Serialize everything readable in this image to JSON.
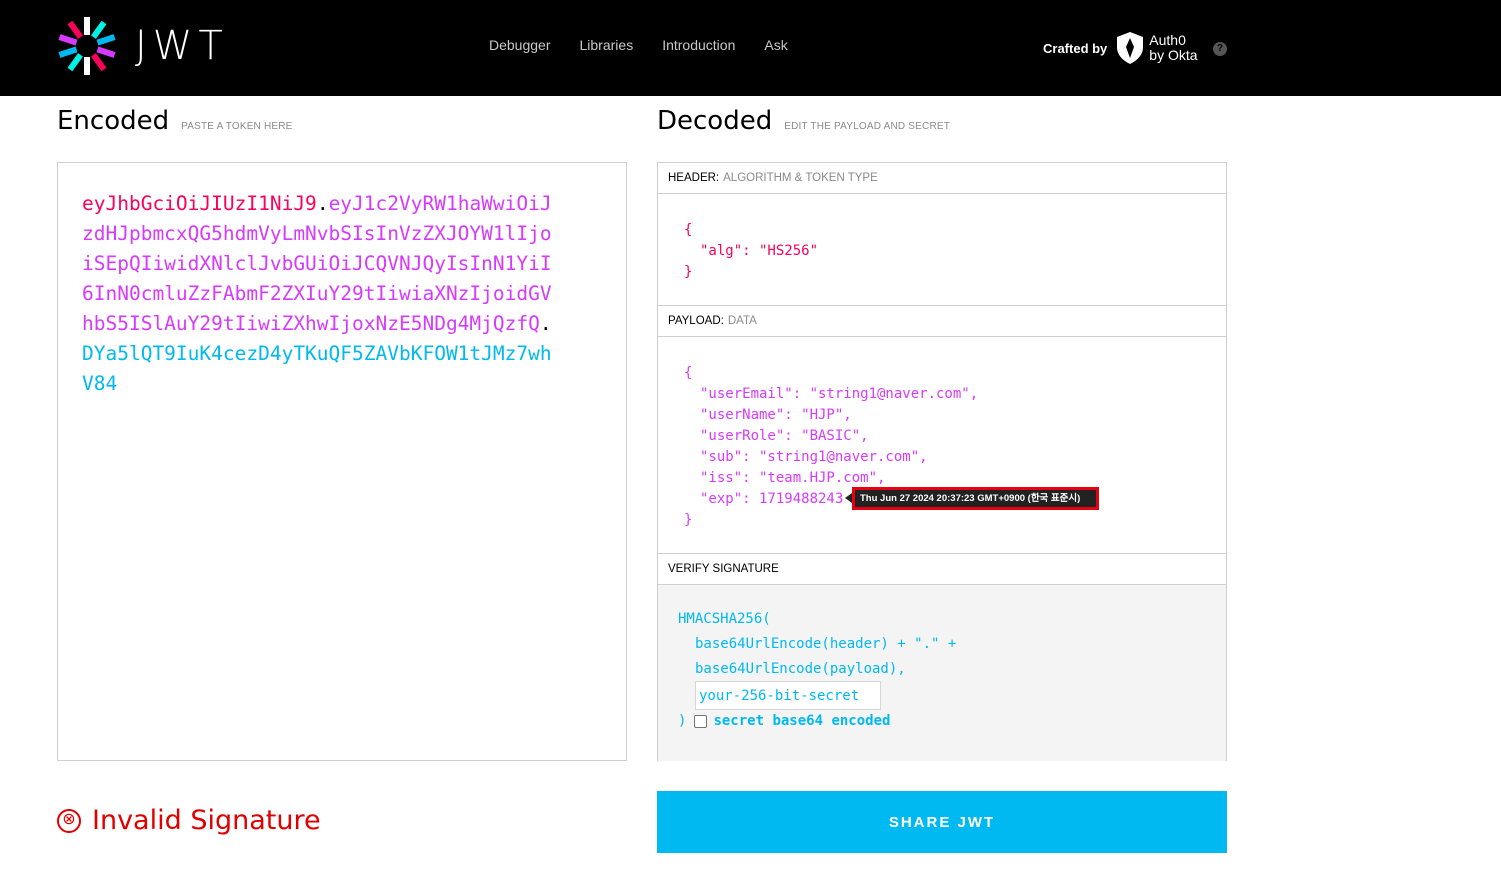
{
  "header": {
    "logo_text": "JWT",
    "nav": [
      "Debugger",
      "Libraries",
      "Introduction",
      "Ask"
    ],
    "crafted_label": "Crafted by",
    "auth0_line1": "Auth0",
    "auth0_line2": "by Okta",
    "help_glyph": "?"
  },
  "encoded": {
    "title": "Encoded",
    "subtitle": "PASTE A TOKEN HERE",
    "token_header": "eyJhbGciOiJIUzI1NiJ9",
    "token_payload": "eyJ1c2VyRW1haWwiOiJzdHJpbmcxQG5hdmVyLmNvbSIsInVzZXJOYW1lIjoiSEpQIiwidXNlclJvbGUiOiJCQVNJQyIsInN1YiI6InN0cmluZzFAbmF2ZXIuY29tIiwiaXNzIjoidGVhbS5ISlAuY29tIiwiZXhwIjoxNzE5NDg4MjQzfQ",
    "token_signature": "DYa5lQT9IuK4cezD4yTKuQF5ZAVbKFOW1tJMz7whV84",
    "dot": "."
  },
  "decoded": {
    "title": "Decoded",
    "subtitle": "EDIT THE PAYLOAD AND SECRET",
    "header_section": {
      "label": "HEADER:",
      "sub": "ALGORITHM & TOKEN TYPE"
    },
    "header_json": {
      "open": "{",
      "line1": "\"alg\": \"HS256\"",
      "close": "}"
    },
    "payload_section": {
      "label": "PAYLOAD:",
      "sub": "DATA"
    },
    "payload_json": {
      "open": "{",
      "userEmail": "\"userEmail\": \"string1@naver.com\",",
      "userName": "\"userName\": \"HJP\",",
      "userRole": "\"userRole\": \"BASIC\",",
      "sub": "\"sub\": \"string1@naver.com\",",
      "iss": "\"iss\": \"team.HJP.com\",",
      "exp": "\"exp\": 1719488243",
      "close": "}"
    },
    "exp_tooltip": "Thu Jun 27 2024 20:37:23 GMT+0900 (한국 표준시)",
    "verify_section": {
      "label": "VERIFY SIGNATURE"
    },
    "verify": {
      "line1": "HMACSHA256(",
      "line2": "base64UrlEncode(header) + \".\" +",
      "line3": "base64UrlEncode(payload),",
      "secret_placeholder": "your-256-bit-secret",
      "close": ")",
      "b64_label": "secret base64 encoded"
    }
  },
  "status": {
    "invalid_text": "Invalid Signature",
    "icon": "⊗"
  },
  "share_button": "SHARE JWT",
  "colors": {
    "header": "#fb015b",
    "payload": "#d63aff",
    "signature": "#00b9f1",
    "error": "#e00000"
  }
}
